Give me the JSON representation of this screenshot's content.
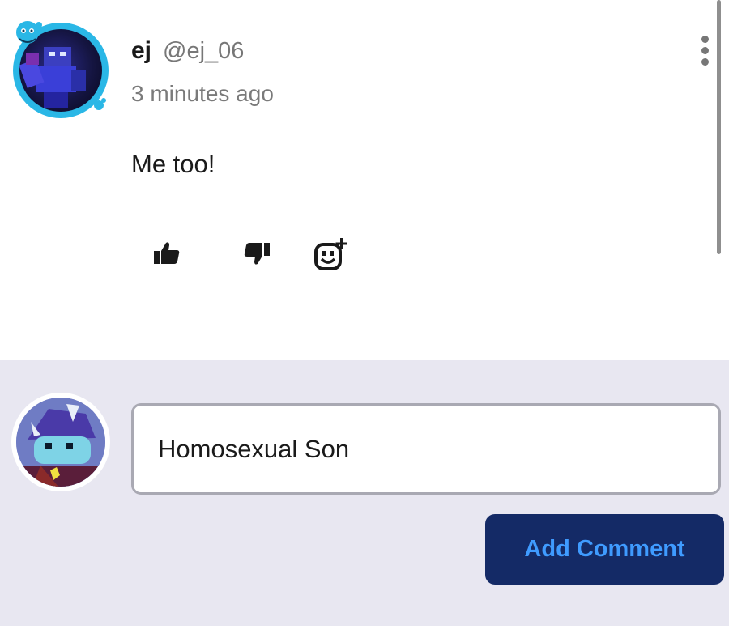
{
  "comment": {
    "username": "ej",
    "handle": "@ej_06",
    "timestamp": "3 minutes ago",
    "body": "Me too!"
  },
  "actions": {
    "like_icon": "thumbs-up-icon",
    "dislike_icon": "thumbs-down-icon",
    "react_icon": "add-reaction-icon",
    "more_icon": "more-vertical-icon"
  },
  "composer": {
    "input_value": "Homosexual Son",
    "submit_label": "Add Comment"
  },
  "colors": {
    "composer_bg": "#e8e7f1",
    "button_bg": "#142a66",
    "button_text": "#3f9bff",
    "avatar_ring": "#2ab7e6"
  }
}
